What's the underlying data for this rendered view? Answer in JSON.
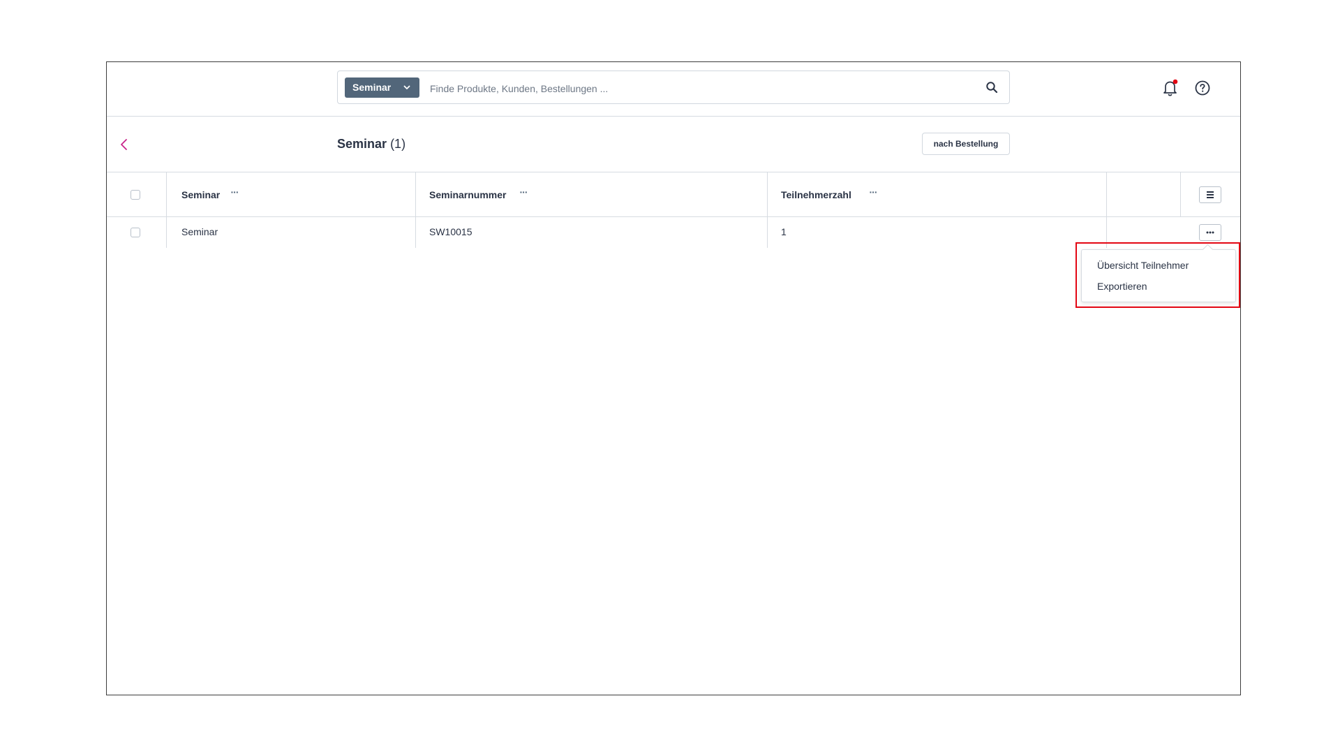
{
  "search": {
    "type_label": "Seminar",
    "placeholder": "Finde Produkte, Kunden, Bestellungen ...",
    "value": ""
  },
  "header": {
    "title": "Seminar",
    "count": "(1)",
    "sort_button_label": "nach Bestellung"
  },
  "table": {
    "columns": [
      {
        "label": "Seminar"
      },
      {
        "label": "Seminarnummer"
      },
      {
        "label": "Teilnehmerzahl"
      }
    ],
    "rows": [
      {
        "seminar": "Seminar",
        "seminarnummer": "SW10015",
        "teilnehmerzahl": "1"
      }
    ]
  },
  "context_menu": {
    "items": [
      {
        "label": "Übersicht Teilnehmer"
      },
      {
        "label": "Exportieren"
      }
    ]
  },
  "icons": {
    "back": "chevron-left-icon",
    "search": "search-icon",
    "bell": "bell-icon",
    "help": "help-icon",
    "settings": "hamburger-menu-icon",
    "row_actions": "more-dots-icon"
  },
  "colors": {
    "search_type_bg": "#52667a",
    "back_accent": "#c8248a",
    "notification_dot": "#e30613",
    "highlight_border": "#e30613"
  }
}
